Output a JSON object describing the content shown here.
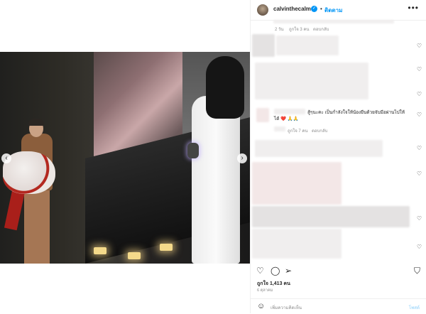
{
  "post": {
    "username": "calvinthecalm",
    "follow_label": "ติดตาม",
    "more_label": "•••"
  },
  "comments": {
    "top_meta": {
      "time": "2 วัน",
      "likes": "ถูกใจ 3 คน",
      "reply": "ตอบกลับ"
    },
    "visible_comment": {
      "text_line1": "สู้ๆนะคะ เป็นกำลังใจให้น้องยืนด้วยจับมือผ่านไปให้",
      "text_line2": "ได้ ❤️ 🙏🙏",
      "likes": "ถูกใจ 7 คน",
      "reply": "ตอบกลับ"
    }
  },
  "actions": {
    "like_icon": "heart-icon",
    "comment_icon": "comment-icon",
    "share_icon": "share-icon",
    "save_icon": "bookmark-icon"
  },
  "likes_text": "ถูกใจ 1,413 คน",
  "date_text": "6 ตุลาคม",
  "add_comment": {
    "placeholder": "เพิ่มความคิดเห็น",
    "post_label": "โพสต์"
  },
  "colors": {
    "accent": "#0095f6",
    "post_disabled": "#b2dffc"
  }
}
